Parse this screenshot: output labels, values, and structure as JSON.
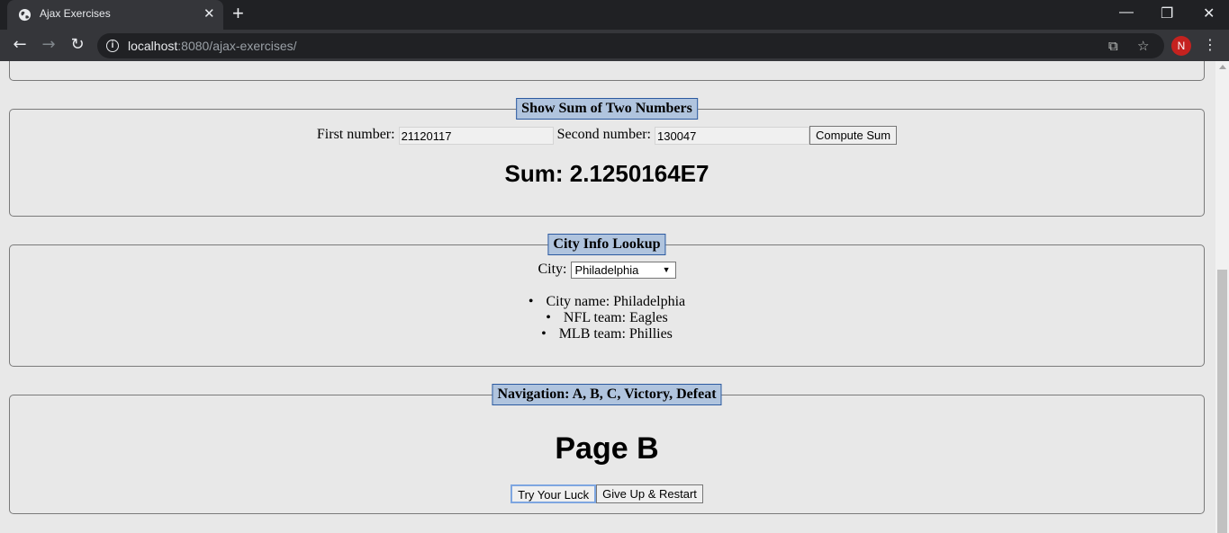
{
  "browser": {
    "tab_title": "Ajax Exercises",
    "tab_close": "✕",
    "new_tab": "+",
    "url_host": "localhost",
    "url_rest": ":8080/ajax-exercises/",
    "avatar_letter": "N",
    "win_minimize": "—",
    "win_restore": "❐",
    "win_close": "✕"
  },
  "sum_section": {
    "legend": "Show Sum of Two Numbers",
    "first_label": "First number:",
    "first_value": "21120117",
    "second_label": "Second number:",
    "second_value": "130047",
    "compute_button": "Compute Sum",
    "result": "Sum: 2.1250164E7"
  },
  "city_section": {
    "legend": "City Info Lookup",
    "city_label": "City:",
    "selected_city": "Philadelphia",
    "info": [
      "City name: Philadelphia",
      "NFL team: Eagles",
      "MLB team: Phillies"
    ]
  },
  "nav_section": {
    "legend": "Navigation: A, B, C, Victory, Defeat",
    "page_heading": "Page B",
    "try_button": "Try Your Luck",
    "giveup_button": "Give Up & Restart"
  },
  "colors": {
    "legend_bg": "#b0c4de",
    "page_bg": "#e8e8e8",
    "avatar": "#c5221f"
  }
}
